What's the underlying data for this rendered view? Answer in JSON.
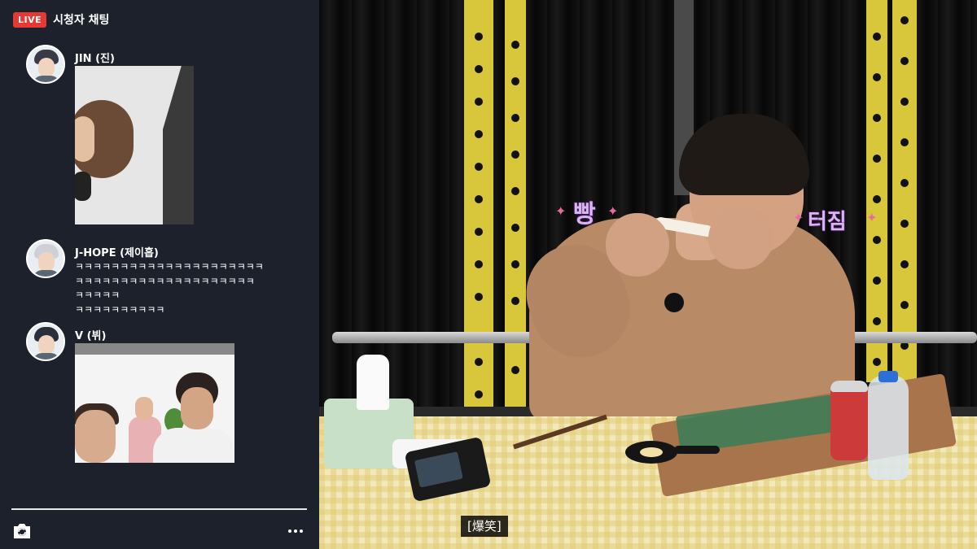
{
  "chat": {
    "live_badge": "LIVE",
    "title": "시청자 채팅",
    "messages": [
      {
        "author": "JIN (진)",
        "avatar_icon": "user-avatar-icon",
        "lines": []
      },
      {
        "author": "J-HOPE (제이홉)",
        "avatar_icon": "user-avatar-icon",
        "lines": [
          "ㅋㅋㅋㅋㅋㅋㅋㅋㅋㅋㅋㅋㅋㅋㅋㅋㅋㅋㅋㅋㅋ",
          "ㅋㅋㅋㅋㅋㅋㅋㅋㅋㅋㅋㅋㅋㅋㅋㅋㅋㅋㅋㅋ",
          "ㅋㅋㅋㅋㅋ",
          "ㅋㅋㅋㅋㅋㅋㅋㅋㅋㅋ"
        ]
      },
      {
        "author": "V (뷔)",
        "avatar_icon": "user-avatar-icon",
        "lines": []
      }
    ],
    "footer": {
      "camera_icon": "camera-switch-icon",
      "more_icon": "more-dots-icon"
    }
  },
  "video": {
    "stickers": [
      "빵",
      "터짐"
    ],
    "subtitle": "[爆笑]"
  },
  "colors": {
    "live": "#e53935",
    "panel": "#1c212c",
    "pole": "#d8c73b"
  }
}
